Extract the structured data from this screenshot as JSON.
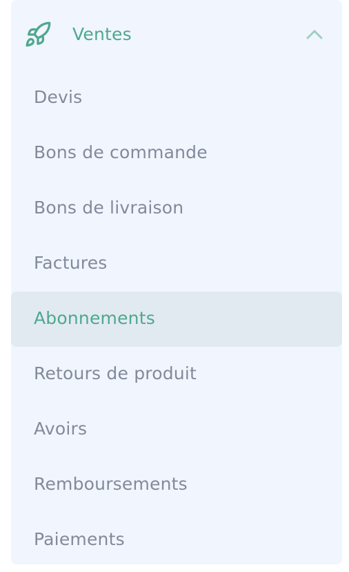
{
  "section": {
    "title": "Ventes",
    "icon": "rocket-icon",
    "toggle_icon": "chevron-up-icon",
    "expanded": true
  },
  "colors": {
    "accent": "#4ea88e",
    "text": "#828a9a",
    "panel_bg": "#f1f5fd",
    "active_bg": "#e2eaf1"
  },
  "menu": {
    "items": [
      {
        "label": "Devis"
      },
      {
        "label": "Bons de commande"
      },
      {
        "label": "Bons de livraison"
      },
      {
        "label": "Factures"
      },
      {
        "label": "Abonnements",
        "active": true
      },
      {
        "label": "Retours de produit"
      },
      {
        "label": "Avoirs"
      },
      {
        "label": "Remboursements"
      },
      {
        "label": "Paiements"
      }
    ]
  }
}
